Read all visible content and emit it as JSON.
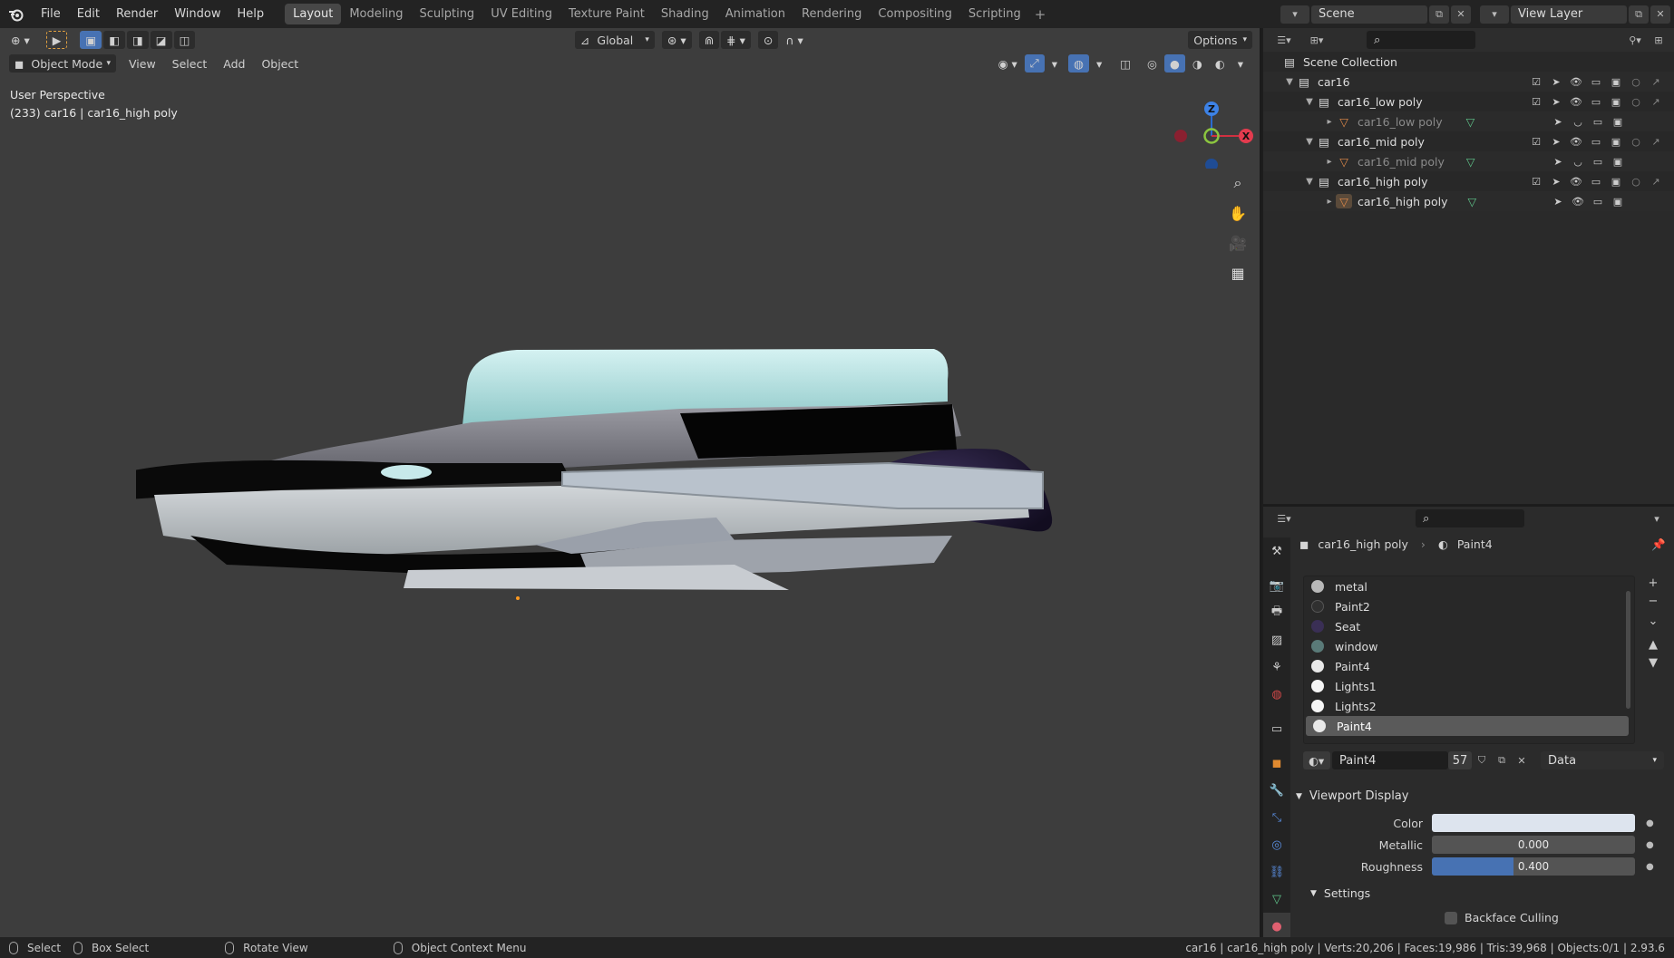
{
  "menu": {
    "items": [
      "File",
      "Edit",
      "Render",
      "Window",
      "Help"
    ]
  },
  "workspaces": {
    "tabs": [
      "Layout",
      "Modeling",
      "Sculpting",
      "UV Editing",
      "Texture Paint",
      "Shading",
      "Animation",
      "Rendering",
      "Compositing",
      "Scripting"
    ],
    "active": "Layout"
  },
  "scene": {
    "name": "Scene",
    "view_layer": "View Layer"
  },
  "viewport": {
    "transform": "Global",
    "options": "Options",
    "mode": "Object Mode",
    "menus": [
      "View",
      "Select",
      "Add",
      "Object"
    ],
    "info_line1": "User Perspective",
    "info_line2": "(233) car16 | car16_high poly",
    "gizmo": {
      "x": "X",
      "y": "Y",
      "z": "Z"
    }
  },
  "outliner": {
    "rows": [
      {
        "label": "Scene Collection"
      },
      {
        "label": "car16"
      },
      {
        "label": "car16_low poly"
      },
      {
        "label": "car16_low poly"
      },
      {
        "label": "car16_mid poly"
      },
      {
        "label": "car16_mid poly"
      },
      {
        "label": "car16_high poly"
      },
      {
        "label": "car16_high poly"
      }
    ]
  },
  "properties": {
    "object": "car16_high poly",
    "material": "Paint4",
    "materials": [
      {
        "name": "metal",
        "color": "#b8b8b8"
      },
      {
        "name": "Paint2",
        "color": "#303030"
      },
      {
        "name": "Seat",
        "color": "#3a2f55"
      },
      {
        "name": "window",
        "color": "#5a7a78"
      },
      {
        "name": "Paint4",
        "color": "#e8e8e8"
      },
      {
        "name": "Lights1",
        "color": "#f5f5f5"
      },
      {
        "name": "Lights2",
        "color": "#f5f5f5"
      },
      {
        "name": "Paint4",
        "color": "#e8e8e8"
      }
    ],
    "slot_name": "Paint4",
    "users": "57",
    "link": "Data",
    "viewport_display": "Viewport Display",
    "color_label": "Color",
    "color_value": "#dde4ee",
    "metallic_label": "Metallic",
    "metallic": "0.000",
    "roughness_label": "Roughness",
    "roughness": "0.400",
    "roughness_fraction": 0.4,
    "settings": "Settings",
    "backface": "Backface Culling"
  },
  "status": {
    "select": "Select",
    "box_select": "Box Select",
    "rotate": "Rotate View",
    "context": "Object Context Menu",
    "stats": "car16 | car16_high poly | Verts:20,206 | Faces:19,986 | Tris:39,968 | Objects:0/1 | 2.93.6"
  }
}
